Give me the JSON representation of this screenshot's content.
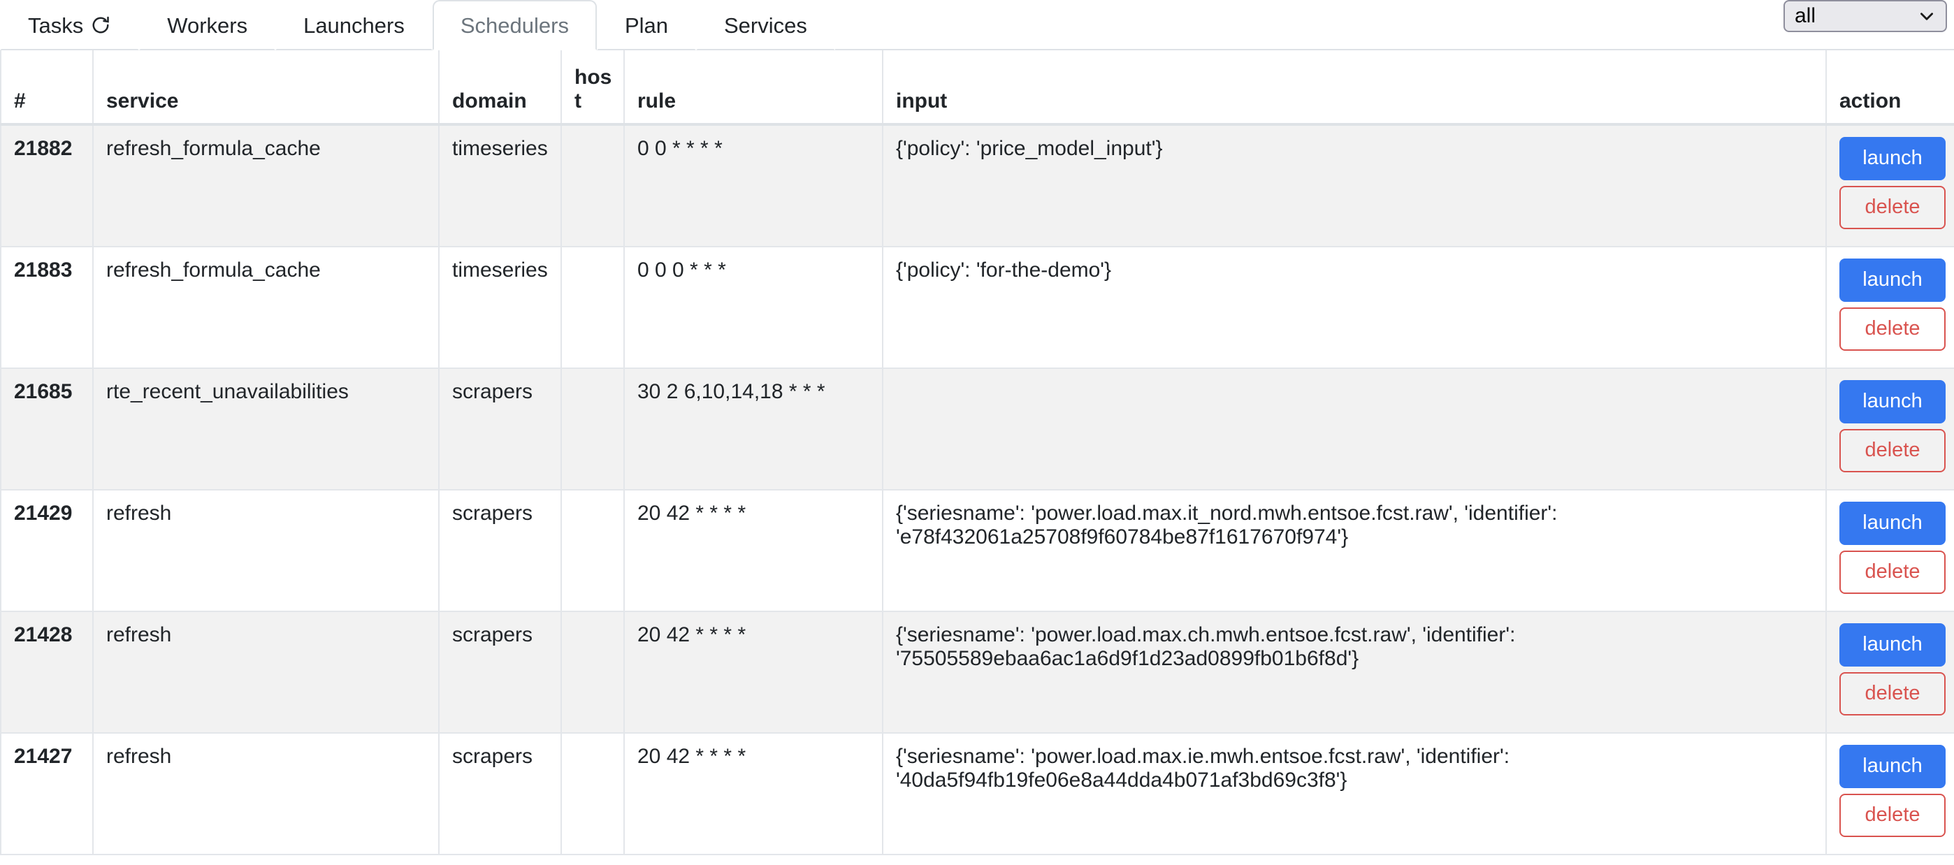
{
  "navbar": {
    "tabs": [
      {
        "label": "Tasks",
        "icon": "refresh-icon",
        "active": false
      },
      {
        "label": "Workers",
        "icon": null,
        "active": false
      },
      {
        "label": "Launchers",
        "icon": null,
        "active": false
      },
      {
        "label": "Schedulers",
        "icon": null,
        "active": true
      },
      {
        "label": "Plan",
        "icon": null,
        "active": false
      },
      {
        "label": "Services",
        "icon": null,
        "active": false
      }
    ],
    "filter": {
      "name": "domain-filter-select",
      "value": "all",
      "icon": "chevron-down-icon"
    }
  },
  "table": {
    "columns": [
      "#",
      "service",
      "domain",
      "host",
      "rule",
      "input",
      "action"
    ],
    "actions": {
      "launch_label": "launch",
      "delete_label": "delete"
    },
    "rows": [
      {
        "id": "21882",
        "service": "refresh_formula_cache",
        "domain": "timeseries",
        "host": "",
        "rule": "0 0 * * * *",
        "input": "{'policy': 'price_model_input'}"
      },
      {
        "id": "21883",
        "service": "refresh_formula_cache",
        "domain": "timeseries",
        "host": "",
        "rule": "0 0 0 * * *",
        "input": "{'policy': 'for-the-demo'}"
      },
      {
        "id": "21685",
        "service": "rte_recent_unavailabilities",
        "domain": "scrapers",
        "host": "",
        "rule": "30 2 6,10,14,18 * * *",
        "input": ""
      },
      {
        "id": "21429",
        "service": "refresh",
        "domain": "scrapers",
        "host": "",
        "rule": "20 42 * * * *",
        "input": "{'seriesname': 'power.load.max.it_nord.mwh.entsoe.fcst.raw', 'identifier': 'e78f432061a25708f9f60784be87f1617670f974'}"
      },
      {
        "id": "21428",
        "service": "refresh",
        "domain": "scrapers",
        "host": "",
        "rule": "20 42 * * * *",
        "input": "{'seriesname': 'power.load.max.ch.mwh.entsoe.fcst.raw', 'identifier': '75505589ebaa6ac1a6d9f1d23ad0899fb01b6f8d'}"
      },
      {
        "id": "21427",
        "service": "refresh",
        "domain": "scrapers",
        "host": "",
        "rule": "20 42 * * * *",
        "input": "{'seriesname': 'power.load.max.ie.mwh.entsoe.fcst.raw', 'identifier': '40da5f94fb19fe06e8a44dda4b071af3bd69c3f8'}"
      }
    ]
  },
  "colors": {
    "launch_button": "#3578f0",
    "delete_button": "#d9534f",
    "active_tab_text": "#6c757d",
    "row_stripe": "#f2f2f2",
    "border": "#e3e6ea"
  }
}
